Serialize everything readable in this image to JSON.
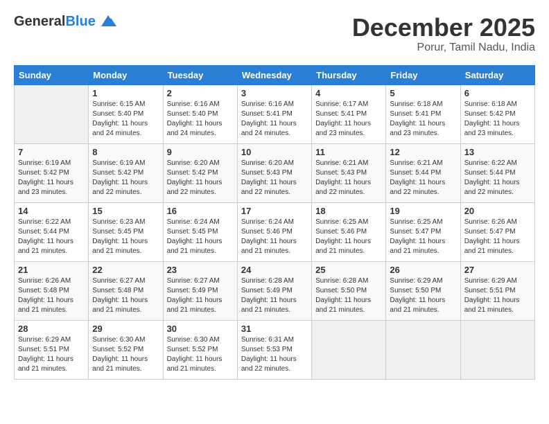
{
  "header": {
    "logo_general": "General",
    "logo_blue": "Blue",
    "month": "December 2025",
    "location": "Porur, Tamil Nadu, India"
  },
  "days_of_week": [
    "Sunday",
    "Monday",
    "Tuesday",
    "Wednesday",
    "Thursday",
    "Friday",
    "Saturday"
  ],
  "weeks": [
    [
      {
        "day": "",
        "info": ""
      },
      {
        "day": "1",
        "info": "Sunrise: 6:15 AM\nSunset: 5:40 PM\nDaylight: 11 hours\nand 24 minutes."
      },
      {
        "day": "2",
        "info": "Sunrise: 6:16 AM\nSunset: 5:40 PM\nDaylight: 11 hours\nand 24 minutes."
      },
      {
        "day": "3",
        "info": "Sunrise: 6:16 AM\nSunset: 5:41 PM\nDaylight: 11 hours\nand 24 minutes."
      },
      {
        "day": "4",
        "info": "Sunrise: 6:17 AM\nSunset: 5:41 PM\nDaylight: 11 hours\nand 23 minutes."
      },
      {
        "day": "5",
        "info": "Sunrise: 6:18 AM\nSunset: 5:41 PM\nDaylight: 11 hours\nand 23 minutes."
      },
      {
        "day": "6",
        "info": "Sunrise: 6:18 AM\nSunset: 5:42 PM\nDaylight: 11 hours\nand 23 minutes."
      }
    ],
    [
      {
        "day": "7",
        "info": "Sunrise: 6:19 AM\nSunset: 5:42 PM\nDaylight: 11 hours\nand 23 minutes."
      },
      {
        "day": "8",
        "info": "Sunrise: 6:19 AM\nSunset: 5:42 PM\nDaylight: 11 hours\nand 22 minutes."
      },
      {
        "day": "9",
        "info": "Sunrise: 6:20 AM\nSunset: 5:42 PM\nDaylight: 11 hours\nand 22 minutes."
      },
      {
        "day": "10",
        "info": "Sunrise: 6:20 AM\nSunset: 5:43 PM\nDaylight: 11 hours\nand 22 minutes."
      },
      {
        "day": "11",
        "info": "Sunrise: 6:21 AM\nSunset: 5:43 PM\nDaylight: 11 hours\nand 22 minutes."
      },
      {
        "day": "12",
        "info": "Sunrise: 6:21 AM\nSunset: 5:44 PM\nDaylight: 11 hours\nand 22 minutes."
      },
      {
        "day": "13",
        "info": "Sunrise: 6:22 AM\nSunset: 5:44 PM\nDaylight: 11 hours\nand 22 minutes."
      }
    ],
    [
      {
        "day": "14",
        "info": "Sunrise: 6:22 AM\nSunset: 5:44 PM\nDaylight: 11 hours\nand 21 minutes."
      },
      {
        "day": "15",
        "info": "Sunrise: 6:23 AM\nSunset: 5:45 PM\nDaylight: 11 hours\nand 21 minutes."
      },
      {
        "day": "16",
        "info": "Sunrise: 6:24 AM\nSunset: 5:45 PM\nDaylight: 11 hours\nand 21 minutes."
      },
      {
        "day": "17",
        "info": "Sunrise: 6:24 AM\nSunset: 5:46 PM\nDaylight: 11 hours\nand 21 minutes."
      },
      {
        "day": "18",
        "info": "Sunrise: 6:25 AM\nSunset: 5:46 PM\nDaylight: 11 hours\nand 21 minutes."
      },
      {
        "day": "19",
        "info": "Sunrise: 6:25 AM\nSunset: 5:47 PM\nDaylight: 11 hours\nand 21 minutes."
      },
      {
        "day": "20",
        "info": "Sunrise: 6:26 AM\nSunset: 5:47 PM\nDaylight: 11 hours\nand 21 minutes."
      }
    ],
    [
      {
        "day": "21",
        "info": "Sunrise: 6:26 AM\nSunset: 5:48 PM\nDaylight: 11 hours\nand 21 minutes."
      },
      {
        "day": "22",
        "info": "Sunrise: 6:27 AM\nSunset: 5:48 PM\nDaylight: 11 hours\nand 21 minutes."
      },
      {
        "day": "23",
        "info": "Sunrise: 6:27 AM\nSunset: 5:49 PM\nDaylight: 11 hours\nand 21 minutes."
      },
      {
        "day": "24",
        "info": "Sunrise: 6:28 AM\nSunset: 5:49 PM\nDaylight: 11 hours\nand 21 minutes."
      },
      {
        "day": "25",
        "info": "Sunrise: 6:28 AM\nSunset: 5:50 PM\nDaylight: 11 hours\nand 21 minutes."
      },
      {
        "day": "26",
        "info": "Sunrise: 6:29 AM\nSunset: 5:50 PM\nDaylight: 11 hours\nand 21 minutes."
      },
      {
        "day": "27",
        "info": "Sunrise: 6:29 AM\nSunset: 5:51 PM\nDaylight: 11 hours\nand 21 minutes."
      }
    ],
    [
      {
        "day": "28",
        "info": "Sunrise: 6:29 AM\nSunset: 5:51 PM\nDaylight: 11 hours\nand 21 minutes."
      },
      {
        "day": "29",
        "info": "Sunrise: 6:30 AM\nSunset: 5:52 PM\nDaylight: 11 hours\nand 21 minutes."
      },
      {
        "day": "30",
        "info": "Sunrise: 6:30 AM\nSunset: 5:52 PM\nDaylight: 11 hours\nand 21 minutes."
      },
      {
        "day": "31",
        "info": "Sunrise: 6:31 AM\nSunset: 5:53 PM\nDaylight: 11 hours\nand 22 minutes."
      },
      {
        "day": "",
        "info": ""
      },
      {
        "day": "",
        "info": ""
      },
      {
        "day": "",
        "info": ""
      }
    ]
  ]
}
